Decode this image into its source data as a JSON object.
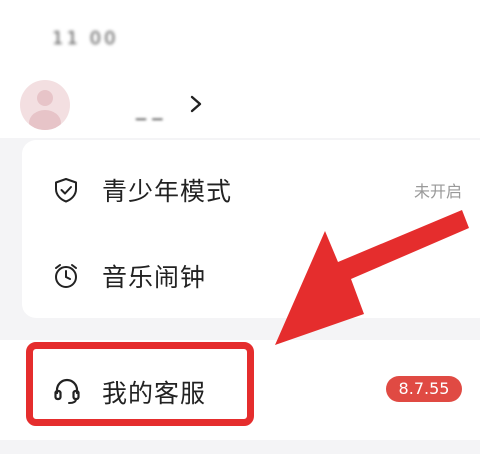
{
  "status": {
    "text": "11 00"
  },
  "profile": {
    "name": "_ _"
  },
  "menu": {
    "youth_mode": {
      "label": "青少年模式",
      "value": "未开启"
    },
    "music_alarm": {
      "label": "音乐闹钟"
    },
    "customer_service": {
      "label": "我的客服",
      "badge": "8.7.55"
    }
  },
  "annotation": {
    "color": "#e52d2d"
  },
  "icons": {
    "youth_mode": "shield-check-icon",
    "music_alarm": "alarm-clock-icon",
    "customer_service": "headset-icon",
    "profile_chevron": "chevron-right-icon"
  }
}
